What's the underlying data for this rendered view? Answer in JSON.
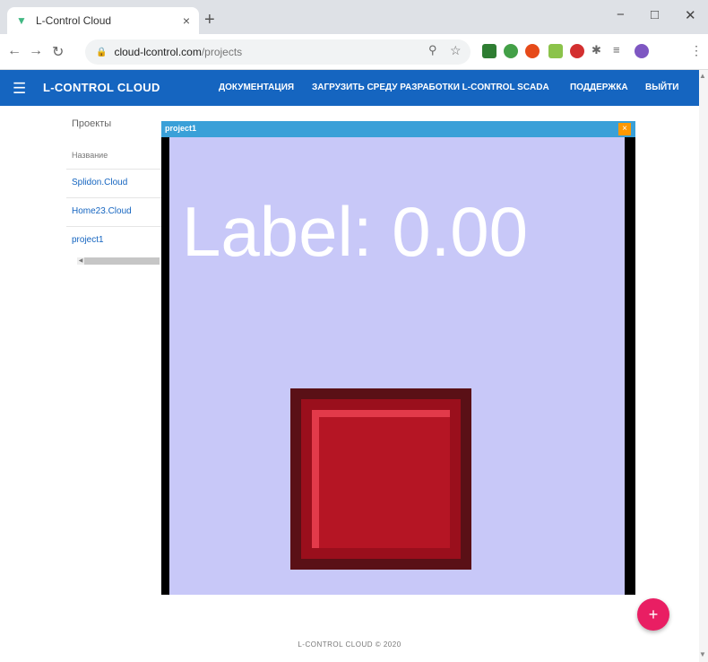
{
  "browser": {
    "tab_title": "L-Control Cloud",
    "tab_close": "×",
    "new_tab": "+",
    "url_host": "cloud-lcontrol.com",
    "url_path": "/projects",
    "window_controls": {
      "minimize": "−",
      "maximize": "□",
      "close": "✕"
    }
  },
  "header": {
    "brand": "L-CONTROL CLOUD",
    "nav": [
      "ДОКУМЕНТАЦИЯ",
      "ЗАГРУЗИТЬ СРЕДУ РАЗРАБОТКИ L-CONTROL SCADA",
      "ПОДДЕРЖКА",
      "ВЫЙТИ"
    ],
    "color": "#1565c0"
  },
  "projects": {
    "title": "Проекты",
    "column": "Название",
    "rows": [
      "Splidon.Cloud",
      "Home23.Cloud",
      "project1"
    ]
  },
  "window": {
    "title": "project1",
    "close": "×",
    "label": "Label: 0.00",
    "canvas_color": "#c8c8f8",
    "button_color": "#b51524"
  },
  "fab": {
    "label": "+",
    "color": "#e91e63"
  },
  "footer": "L-CONTROL CLOUD © 2020"
}
